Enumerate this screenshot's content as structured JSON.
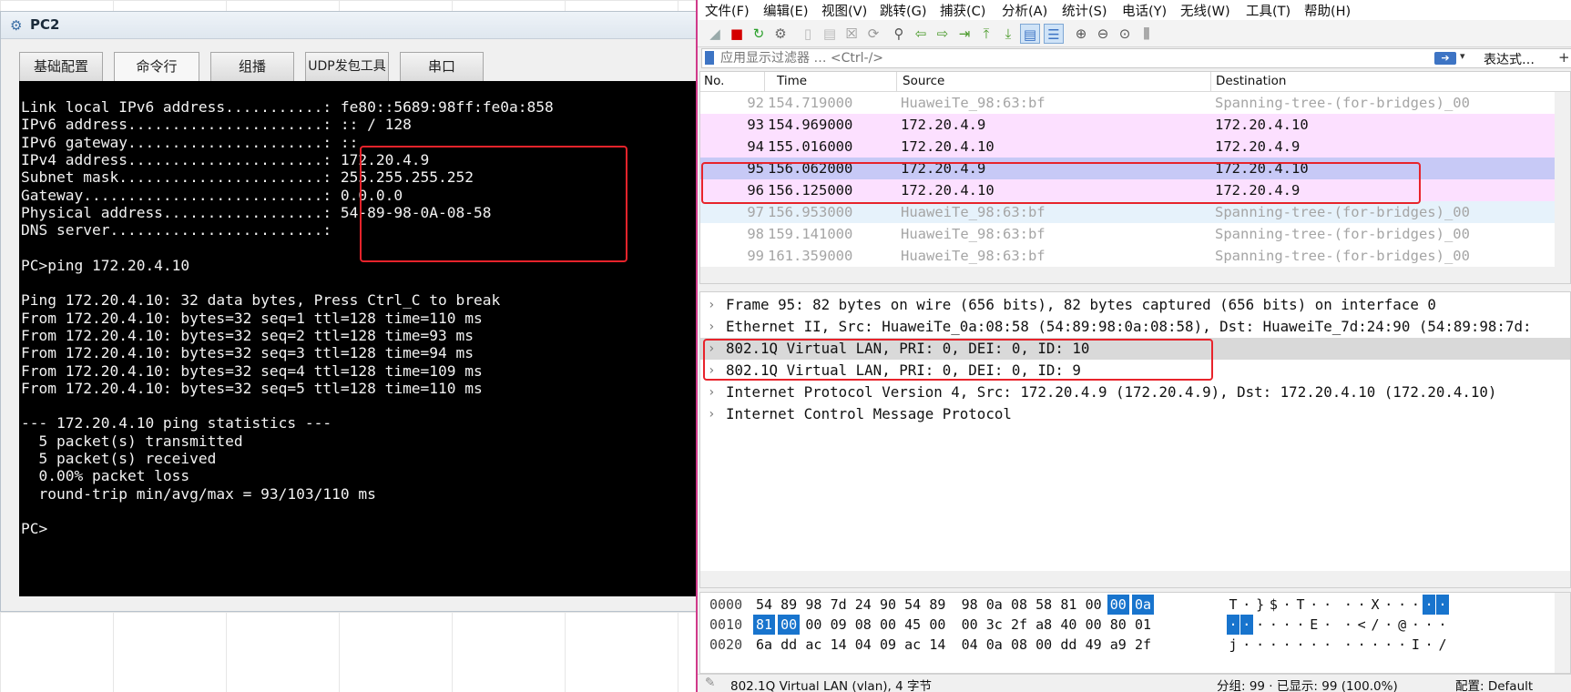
{
  "pc": {
    "title": "PC2",
    "tabs": [
      "基础配置",
      "命令行",
      "组播",
      "UDP发包工具",
      "串口"
    ],
    "terminal_lines": [
      "Link local IPv6 address...........: fe80::5689:98ff:fe0a:858",
      "IPv6 address......................: :: / 128",
      "IPv6 gateway......................: ::",
      "IPv4 address......................: 172.20.4.9",
      "Subnet mask.......................: 255.255.255.252",
      "Gateway...........................: 0.0.0.0",
      "Physical address..................: 54-89-98-0A-08-58",
      "DNS server........................:",
      "",
      "PC>ping 172.20.4.10",
      "",
      "Ping 172.20.4.10: 32 data bytes, Press Ctrl_C to break",
      "From 172.20.4.10: bytes=32 seq=1 ttl=128 time=110 ms",
      "From 172.20.4.10: bytes=32 seq=2 ttl=128 time=93 ms",
      "From 172.20.4.10: bytes=32 seq=3 ttl=128 time=94 ms",
      "From 172.20.4.10: bytes=32 seq=4 ttl=128 time=109 ms",
      "From 172.20.4.10: bytes=32 seq=5 ttl=128 time=110 ms",
      "",
      "--- 172.20.4.10 ping statistics ---",
      "  5 packet(s) transmitted",
      "  5 packet(s) received",
      "  0.00% packet loss",
      "  round-trip min/avg/max = 93/103/110 ms",
      "",
      "PC>"
    ]
  },
  "wireshark": {
    "menu": [
      "文件(F)",
      "编辑(E)",
      "视图(V)",
      "跳转(G)",
      "捕获(C)",
      "分析(A)",
      "统计(S)",
      "电话(Y)",
      "无线(W)",
      "工具(T)",
      "帮助(H)"
    ],
    "filter": {
      "placeholder": "应用显示过滤器 … <Ctrl-/>",
      "expression_label": "表达式…",
      "plus_label": "+"
    },
    "columns": [
      "No.",
      "Time",
      "Source",
      "Destination"
    ],
    "packets": [
      {
        "no": "92",
        "time": "154.719000",
        "src": "HuaweiTe_98:63:bf",
        "dst": "Spanning-tree-(for-bridges)_00",
        "kind": "stp"
      },
      {
        "no": "93",
        "time": "154.969000",
        "src": "172.20.4.9",
        "dst": "172.20.4.10",
        "kind": "icmp"
      },
      {
        "no": "94",
        "time": "155.016000",
        "src": "172.20.4.10",
        "dst": "172.20.4.9",
        "kind": "icmp"
      },
      {
        "no": "95",
        "time": "156.062000",
        "src": "172.20.4.9",
        "dst": "172.20.4.10",
        "kind": "selected"
      },
      {
        "no": "96",
        "time": "156.125000",
        "src": "172.20.4.10",
        "dst": "172.20.4.9",
        "kind": "icmp"
      },
      {
        "no": "97",
        "time": "156.953000",
        "src": "HuaweiTe_98:63:bf",
        "dst": "Spanning-tree-(for-bridges)_00",
        "kind": "stp-blue"
      },
      {
        "no": "98",
        "time": "159.141000",
        "src": "HuaweiTe_98:63:bf",
        "dst": "Spanning-tree-(for-bridges)_00",
        "kind": "stp"
      },
      {
        "no": "99",
        "time": "161.359000",
        "src": "HuaweiTe_98:63:bf",
        "dst": "Spanning-tree-(for-bridges)_00",
        "kind": "stp"
      }
    ],
    "details": [
      "Frame 95: 82 bytes on wire (656 bits), 82 bytes captured (656 bits) on interface 0",
      "Ethernet II, Src: HuaweiTe_0a:08:58 (54:89:98:0a:08:58), Dst: HuaweiTe_7d:24:90 (54:89:98:7d:",
      "802.1Q Virtual LAN, PRI: 0, DEI: 0, ID: 10",
      "802.1Q Virtual LAN, PRI: 0, DEI: 0, ID: 9",
      "Internet Protocol Version 4, Src: 172.20.4.9 (172.20.4.9), Dst: 172.20.4.10 (172.20.4.10)",
      "Internet Control Message Protocol"
    ],
    "hex_rows": [
      {
        "offset": "0000",
        "bytes": [
          "54",
          "89",
          "98",
          "7d",
          "24",
          "90",
          "54",
          "89",
          "98",
          "0a",
          "08",
          "58",
          "81",
          "00",
          "00",
          "0a"
        ],
        "ascii": [
          "T",
          "·",
          "}",
          "$",
          "·",
          "T",
          "·",
          "·",
          "·",
          "·",
          "X",
          "·",
          "·",
          "·",
          "·",
          "·"
        ],
        "sel": [
          14,
          15
        ]
      },
      {
        "offset": "0010",
        "bytes": [
          "81",
          "00",
          "00",
          "09",
          "08",
          "00",
          "45",
          "00",
          "00",
          "3c",
          "2f",
          "a8",
          "40",
          "00",
          "80",
          "01"
        ],
        "ascii": [
          "·",
          "·",
          "·",
          "·",
          "·",
          "·",
          "E",
          "·",
          "·",
          "<",
          "/",
          "·",
          "@",
          "·",
          "·",
          "·"
        ],
        "sel": [
          0,
          1
        ]
      },
      {
        "offset": "0020",
        "bytes": [
          "6a",
          "dd",
          "ac",
          "14",
          "04",
          "09",
          "ac",
          "14",
          "04",
          "0a",
          "08",
          "00",
          "dd",
          "49",
          "a9",
          "2f"
        ],
        "ascii": [
          "j",
          "·",
          "·",
          "·",
          "·",
          "·",
          "·",
          "·",
          "·",
          "·",
          "·",
          "·",
          "·",
          "I",
          "·",
          "/"
        ],
        "sel": []
      }
    ],
    "status": {
      "field_info": "802.1Q Virtual LAN (vlan), 4 字节",
      "packets": "分组: 99 · 已显示: 99 (100.0%)",
      "profile": "配置: Default"
    },
    "colors": {
      "icmp_row": "#fce0ff",
      "selected_row": "#c7c9f6",
      "stp_blue_row": "#e6f2fb",
      "stp_text": "#a5a5a5",
      "highlight_box": "#e8232b",
      "hex_selection": "#1874cd"
    }
  }
}
